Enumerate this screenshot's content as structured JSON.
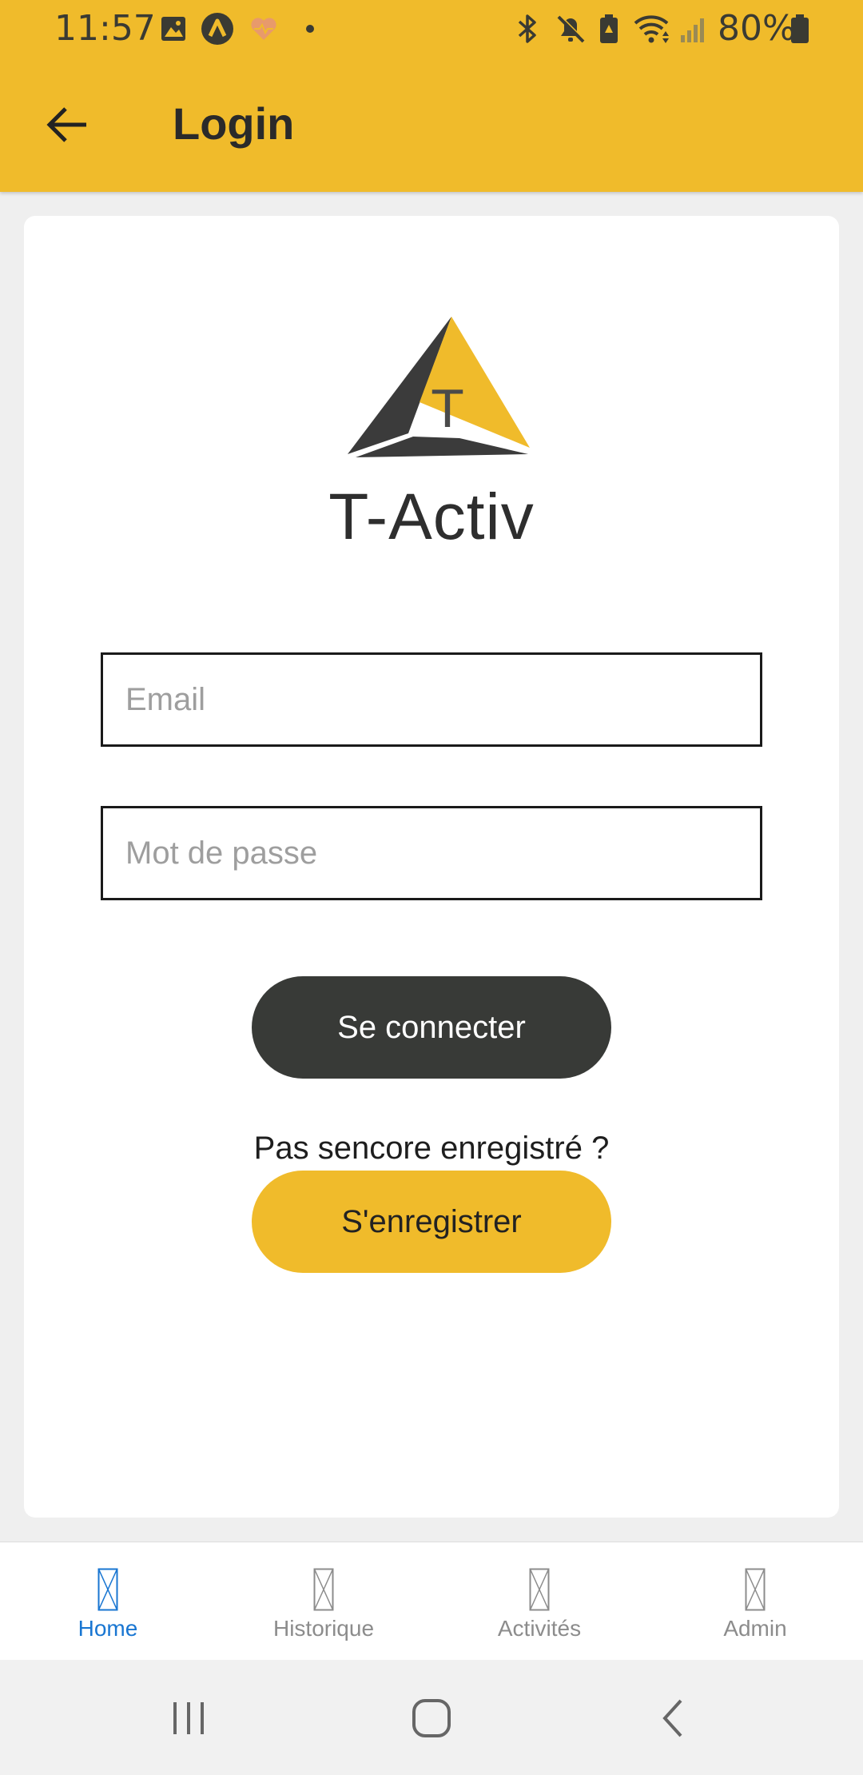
{
  "status_bar": {
    "time": "11:57",
    "battery": "80%",
    "icons": [
      "image-icon",
      "app-icon",
      "heart-icon",
      "dot-icon",
      "bluetooth-icon",
      "mute-icon",
      "battery-saver-icon",
      "wifi-icon",
      "signal-icon",
      "battery-icon"
    ]
  },
  "app_bar": {
    "title": "Login",
    "back_icon": "arrow-left-icon"
  },
  "logo": {
    "letter": "T",
    "brand": "T-Activ"
  },
  "form": {
    "email_placeholder": "Email",
    "password_placeholder": "Mot de passe",
    "login_label": "Se connecter",
    "register_prompt": "Pas sencore enregistré ?",
    "register_label": "S'enregistrer"
  },
  "tabs": [
    {
      "label": "Home",
      "active": true
    },
    {
      "label": "Historique",
      "active": false
    },
    {
      "label": "Activités",
      "active": false
    },
    {
      "label": "Admin",
      "active": false
    }
  ],
  "colors": {
    "accent": "#f0bb2b",
    "dark_button": "#383a37",
    "active_tab": "#1976d2"
  }
}
